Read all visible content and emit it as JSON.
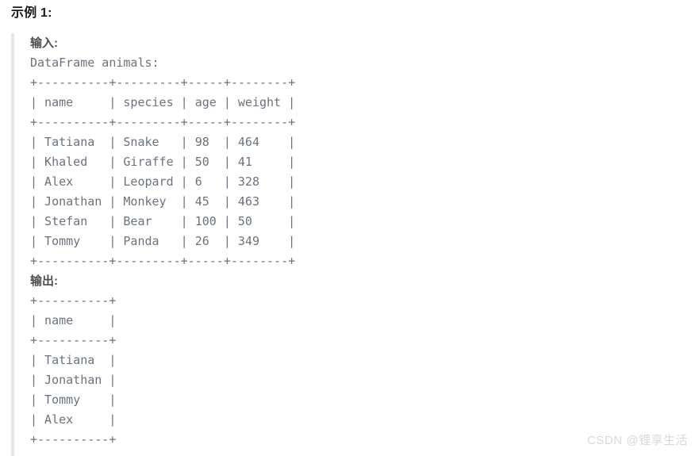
{
  "title": "示例 1:",
  "input": {
    "label": "输入:",
    "caption": "DataFrame animals:",
    "table_text": "+----------+---------+-----+--------+\n| name     | species | age | weight |\n+----------+---------+-----+--------+\n| Tatiana  | Snake   | 98  | 464    |\n| Khaled   | Giraffe | 50  | 41     |\n| Alex     | Leopard | 6   | 328    |\n| Jonathan | Monkey  | 45  | 463    |\n| Stefan   | Bear    | 100 | 50     |\n| Tommy    | Panda   | 26  | 349    |\n+----------+---------+-----+--------+",
    "columns": [
      "name",
      "species",
      "age",
      "weight"
    ],
    "rows": [
      [
        "Tatiana",
        "Snake",
        "98",
        "464"
      ],
      [
        "Khaled",
        "Giraffe",
        "50",
        "41"
      ],
      [
        "Alex",
        "Leopard",
        "6",
        "328"
      ],
      [
        "Jonathan",
        "Monkey",
        "45",
        "463"
      ],
      [
        "Stefan",
        "Bear",
        "100",
        "50"
      ],
      [
        "Tommy",
        "Panda",
        "26",
        "349"
      ]
    ]
  },
  "output": {
    "label": "输出:",
    "table_text": "+----------+\n| name     |\n+----------+\n| Tatiana  |\n| Jonathan |\n| Tommy    |\n| Alex     |\n+----------+",
    "columns": [
      "name"
    ],
    "rows": [
      [
        "Tatiana"
      ],
      [
        "Jonathan"
      ],
      [
        "Tommy"
      ],
      [
        "Alex"
      ]
    ]
  },
  "watermark": "CSDN @锂享生活",
  "colors": {
    "text_dark": "#1a1a1a",
    "label": "#4d4d4d",
    "code": "#6a737d",
    "quote_border": "#e8e8e8",
    "watermark": "#d9d9d9",
    "background": "#ffffff"
  }
}
